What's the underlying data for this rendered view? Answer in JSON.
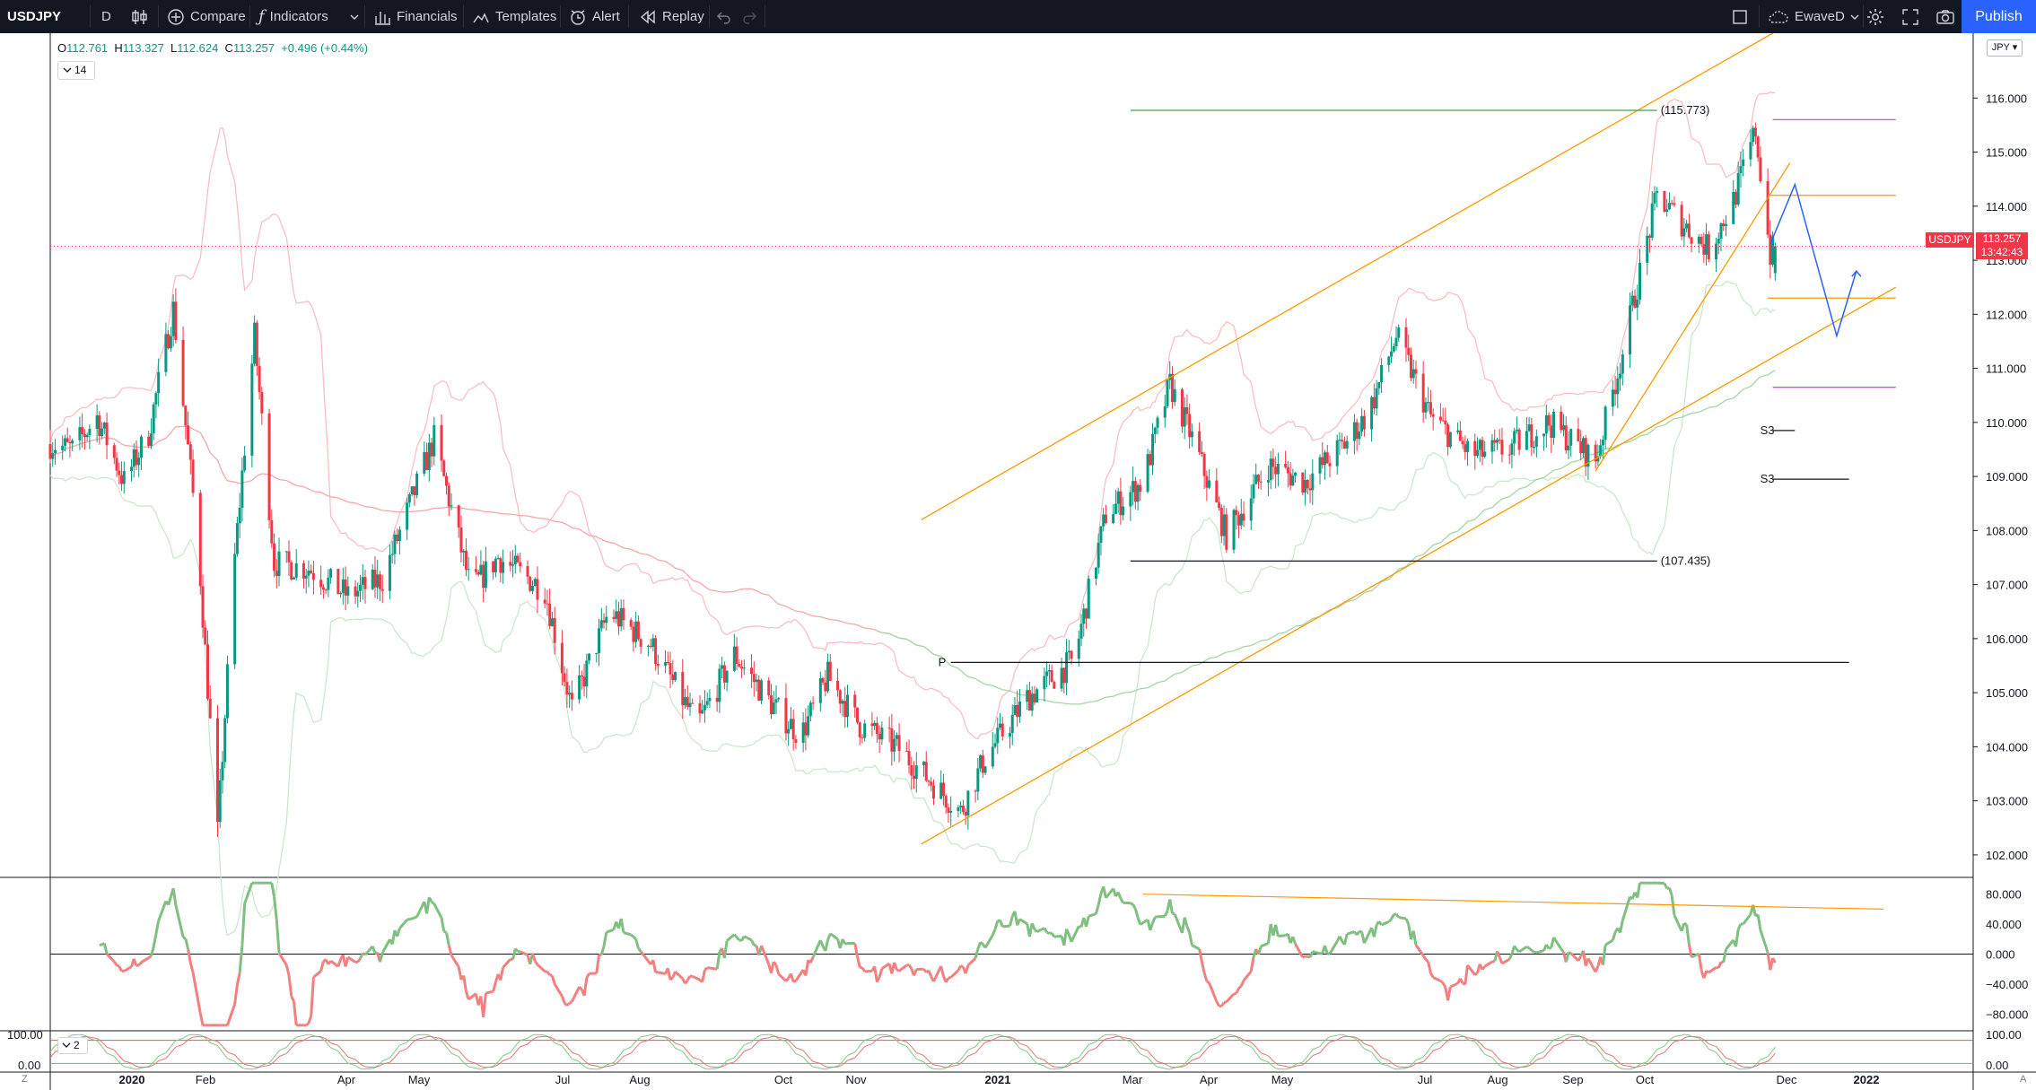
{
  "toolbar": {
    "symbol": "USDJPY",
    "interval": "D",
    "compare_label": "Compare",
    "indicators_label": "Indicators",
    "financials_label": "Financials",
    "templates_label": "Templates",
    "alert_label": "Alert",
    "replay_label": "Replay",
    "layout_name": "EwaveD",
    "publish_label": "Publish"
  },
  "legend": {
    "open_label": "O",
    "open": "112.761",
    "high_label": "H",
    "high": "113.327",
    "low_label": "L",
    "low": "112.624",
    "close_label": "C",
    "close": "113.257",
    "change": "+0.496 (+0.44%)",
    "indicator_toggle": "14",
    "sub_toggle": "2"
  },
  "price_scale": {
    "currency": "JPY",
    "labels": [
      "116.000",
      "115.000",
      "114.000",
      "113.000",
      "112.000",
      "111.000",
      "110.000",
      "109.000",
      "108.000",
      "107.000",
      "106.000",
      "105.000",
      "104.000",
      "103.000",
      "102.000"
    ],
    "current_symbol": "USDJPY",
    "current_price": "113.257",
    "countdown": "13:42:43"
  },
  "oscillator_scale": {
    "labels": [
      "80.000",
      "40.000",
      "0.000",
      "−40.000",
      "−80.000"
    ]
  },
  "stoch_scale": {
    "labels": [
      "100.00",
      "0.00"
    ],
    "right_label": "100.00",
    "right_bottom": "0.00"
  },
  "time_axis": {
    "labels": [
      {
        "text": "2020",
        "bold": true
      },
      {
        "text": "Feb"
      },
      {
        "text": "Apr"
      },
      {
        "text": "May"
      },
      {
        "text": "Jul"
      },
      {
        "text": "Aug"
      },
      {
        "text": "Oct"
      },
      {
        "text": "Nov"
      },
      {
        "text": "2021",
        "bold": true
      },
      {
        "text": "Mar"
      },
      {
        "text": "Apr"
      },
      {
        "text": "May"
      },
      {
        "text": "Jul"
      },
      {
        "text": "Aug"
      },
      {
        "text": "Sep"
      },
      {
        "text": "Oct"
      },
      {
        "text": "Dec"
      },
      {
        "text": "2022",
        "bold": true
      }
    ],
    "left_corner": "Z",
    "right_corner": "A"
  },
  "annotations": {
    "upper_level": "(115.773)",
    "lower_level": "(107.435)",
    "pivot_label": "P",
    "s3_label": "S3"
  },
  "colors": {
    "up": "#089981",
    "down": "#f23645",
    "channel": "#ff9800",
    "wave": "#2962ff",
    "current_tag": "#f23645",
    "bands": "#f8bbbf",
    "oscillator_up": "#7fbf7f",
    "oscillator_down": "#f28080"
  },
  "chart_data": {
    "type": "candlestick",
    "symbol": "USDJPY",
    "interval": "D",
    "y_range": [
      101.6,
      117.2
    ],
    "x_range": [
      "2020-01-01",
      "2022-01-15"
    ],
    "ohlc_last": {
      "open": 112.761,
      "high": 113.327,
      "low": 112.624,
      "close": 113.257
    },
    "close_path": [
      [
        "2020-01-01",
        109.6
      ],
      [
        "2020-01-10",
        109.5
      ],
      [
        "2020-01-20",
        110.1
      ],
      [
        "2020-01-31",
        108.9
      ],
      [
        "2020-02-10",
        109.8
      ],
      [
        "2020-02-20",
        112.1
      ],
      [
        "2020-03-01",
        107.8
      ],
      [
        "2020-03-09",
        102.4
      ],
      [
        "2020-03-16",
        107.5
      ],
      [
        "2020-03-24",
        111.6
      ],
      [
        "2020-04-01",
        107.4
      ],
      [
        "2020-04-15",
        107.3
      ],
      [
        "2020-05-01",
        106.8
      ],
      [
        "2020-05-15",
        107.1
      ],
      [
        "2020-06-05",
        109.7
      ],
      [
        "2020-06-20",
        106.9
      ],
      [
        "2020-07-01",
        107.5
      ],
      [
        "2020-07-20",
        106.9
      ],
      [
        "2020-07-31",
        104.7
      ],
      [
        "2020-08-15",
        106.5
      ],
      [
        "2020-09-01",
        105.9
      ],
      [
        "2020-09-20",
        104.4
      ],
      [
        "2020-10-05",
        105.7
      ],
      [
        "2020-10-20",
        104.8
      ],
      [
        "2020-11-01",
        104.2
      ],
      [
        "2020-11-12",
        105.3
      ],
      [
        "2020-11-25",
        104.4
      ],
      [
        "2020-12-10",
        104.0
      ],
      [
        "2021-01-05",
        102.8
      ],
      [
        "2021-01-15",
        103.8
      ],
      [
        "2021-02-01",
        104.9
      ],
      [
        "2021-02-20",
        105.6
      ],
      [
        "2021-03-05",
        108.3
      ],
      [
        "2021-03-20",
        108.9
      ],
      [
        "2021-03-31",
        110.7
      ],
      [
        "2021-04-10",
        109.6
      ],
      [
        "2021-04-23",
        107.9
      ],
      [
        "2021-05-10",
        109.2
      ],
      [
        "2021-05-25",
        108.9
      ],
      [
        "2021-06-10",
        109.6
      ],
      [
        "2021-06-20",
        110.2
      ],
      [
        "2021-07-01",
        111.6
      ],
      [
        "2021-07-15",
        110.1
      ],
      [
        "2021-08-01",
        109.4
      ],
      [
        "2021-08-15",
        109.5
      ],
      [
        "2021-09-01",
        110.0
      ],
      [
        "2021-09-20",
        109.3
      ],
      [
        "2021-10-01",
        111.3
      ],
      [
        "2021-10-15",
        114.2
      ],
      [
        "2021-10-25",
        113.7
      ],
      [
        "2021-11-05",
        113.2
      ],
      [
        "2021-11-15",
        114.1
      ],
      [
        "2021-11-24",
        115.4
      ],
      [
        "2021-11-30",
        113.1
      ],
      [
        "2021-12-02",
        113.257
      ]
    ],
    "horizontal_levels": [
      {
        "label": "(115.773)",
        "price": 115.773,
        "from": "2021-03-15",
        "to": "2021-10-15"
      },
      {
        "label": "(107.435)",
        "price": 107.435,
        "from": "2021-03-15",
        "to": "2021-10-15"
      },
      {
        "label": "P",
        "price": 105.56,
        "from": "2021-01-01",
        "to": "2022-01-01"
      },
      {
        "label": "S3",
        "price": 109.85,
        "from": "2021-12-01",
        "to": "2021-12-10"
      },
      {
        "label": "S3",
        "price": 108.95,
        "from": "2021-12-01",
        "to": "2022-01-01"
      }
    ],
    "channel_lines": [
      {
        "from": [
          "2020-12-20",
          102.2
        ],
        "to": [
          "2022-01-20",
          112.5
        ]
      },
      {
        "from": [
          "2020-12-20",
          108.2
        ],
        "to": [
          "2021-12-01",
          117.2
        ]
      }
    ],
    "oscillator": {
      "range": [
        -100,
        100
      ],
      "ticks": [
        80,
        40,
        0,
        -40,
        -80
      ],
      "last": -10
    },
    "stochastic": {
      "range": [
        0,
        100
      ],
      "ticks": [
        100,
        0
      ]
    }
  }
}
